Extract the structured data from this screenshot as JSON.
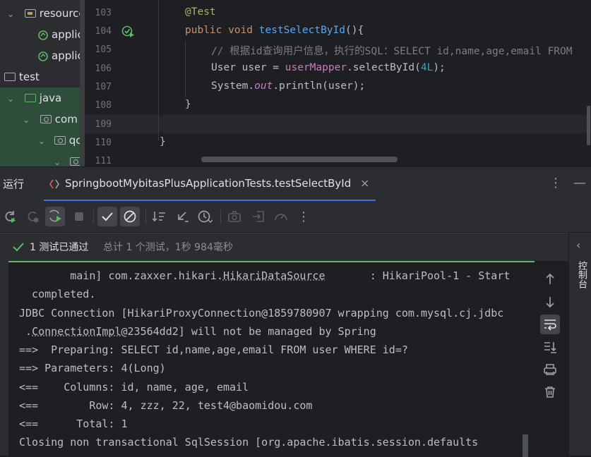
{
  "project_tree": {
    "items": [
      {
        "label": "resources",
        "kind": "res-folder",
        "chevron": "v"
      },
      {
        "label": "applic",
        "kind": "spring-file",
        "chevron": ""
      },
      {
        "label": "applic",
        "kind": "spring-file",
        "chevron": ""
      },
      {
        "label": "test",
        "kind": "folder",
        "chevron": ""
      },
      {
        "label": "java",
        "kind": "java-folder",
        "chevron": "v"
      },
      {
        "label": "com",
        "kind": "package",
        "chevron": "v"
      },
      {
        "label": "qc",
        "kind": "package",
        "chevron": "v"
      },
      {
        "label": "",
        "kind": "package",
        "chevron": "v"
      }
    ]
  },
  "editor": {
    "lines": [
      {
        "no": "103"
      },
      {
        "no": "104",
        "parts": [
          [
            "kw",
            "public "
          ],
          [
            "kw",
            "void "
          ],
          [
            "fn",
            "testSelectById"
          ],
          [
            "",
            "(){"
          ]
        ]
      },
      {
        "no": "105"
      },
      {
        "no": "106"
      },
      {
        "no": "107"
      },
      {
        "no": "108",
        "parts": [
          [
            "",
            "}"
          ]
        ]
      },
      {
        "no": "109"
      },
      {
        "no": "110",
        "parts": [
          [
            "",
            "}"
          ]
        ]
      },
      {
        "no": "111"
      }
    ],
    "annotation": "@Test",
    "comment": "// 根据id查询用户信息，执行的SQL：SELECT id,name,age,email FROM",
    "line106": {
      "a": "User user = ",
      "field": "userMapper",
      "b": ".selectById(",
      "num": "4L",
      "c": ");"
    },
    "line107": {
      "a": "System.",
      "stat": "out",
      "b": ".println(user);"
    }
  },
  "run_window": {
    "title": "运行",
    "tab_label": "SpringbootMybitasPlusApplicationTests.testSelectById",
    "close_glyph": "×",
    "more_glyph": "⋮",
    "minimize_glyph": "—"
  },
  "status": {
    "label": "1 测试已通过",
    "summary": "总计 1 个测试，1秒 984毫秒"
  },
  "console": {
    "l1a": "        main] com.zaxxer.hikari.",
    "l1u": "HikariDataSource",
    "l1b": "       : HikariPool-1 - Start",
    "l2": "  completed.",
    "l3": "JDBC Connection [HikariProxyConnection@1859780907 wrapping com.mysql.cj.jdbc",
    "l4u": "ConnectionImpl",
    "l4a": " .",
    "l4b": "@23564dd2] will not be managed by Spring",
    "l5": "==>  Preparing: SELECT id,name,age,email FROM user WHERE id=?",
    "l6": "==> Parameters: 4(Long)",
    "l7": "<==    Columns: id, name, age, email",
    "l8": "<==        Row: 4, zzz, 22, test4@baomidou.com",
    "l9": "<==      Total: 1",
    "l10": "Closing non transactional SqlSession [org.apache.ibatis.session.defaults"
  },
  "right_panel": {
    "chevron": "‹",
    "label": "控制台"
  },
  "colors": {
    "accent": "#3574f0",
    "pass": "#5fb865",
    "keyword": "#cf8e6d",
    "function": "#56a8f5"
  }
}
